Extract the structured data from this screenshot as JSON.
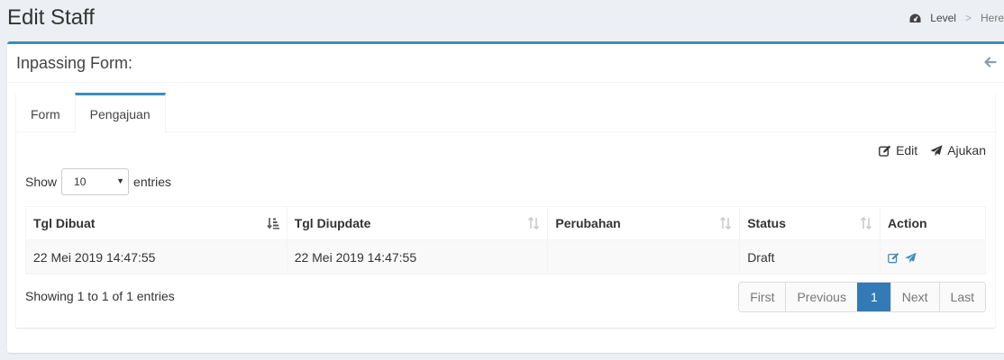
{
  "header": {
    "title": "Edit Staff"
  },
  "breadcrumb": {
    "level": "Level",
    "sep": ">",
    "here": "Here"
  },
  "box": {
    "title": "Inpassing Form:"
  },
  "tabs": [
    {
      "label": "Form"
    },
    {
      "label": "Pengajuan"
    }
  ],
  "toolbar": {
    "edit_label": "Edit",
    "submit_label": "Ajukan"
  },
  "length": {
    "show": "Show",
    "value": "10",
    "entries": "entries"
  },
  "table": {
    "headers": [
      "Tgl Dibuat",
      "Tgl Diupdate",
      "Perubahan",
      "Status",
      "Action"
    ],
    "rows": [
      {
        "created": "22 Mei 2019 14:47:55",
        "updated": "22 Mei 2019 14:47:55",
        "change": "",
        "status": "Draft"
      }
    ]
  },
  "info": "Showing 1 to 1 of 1 entries",
  "pagination": {
    "first": "First",
    "previous": "Previous",
    "current": "1",
    "next": "Next",
    "last": "Last"
  },
  "colors": {
    "accent": "#3c8dbc",
    "link": "#3c8dbc",
    "active_page": "#337ab7"
  }
}
